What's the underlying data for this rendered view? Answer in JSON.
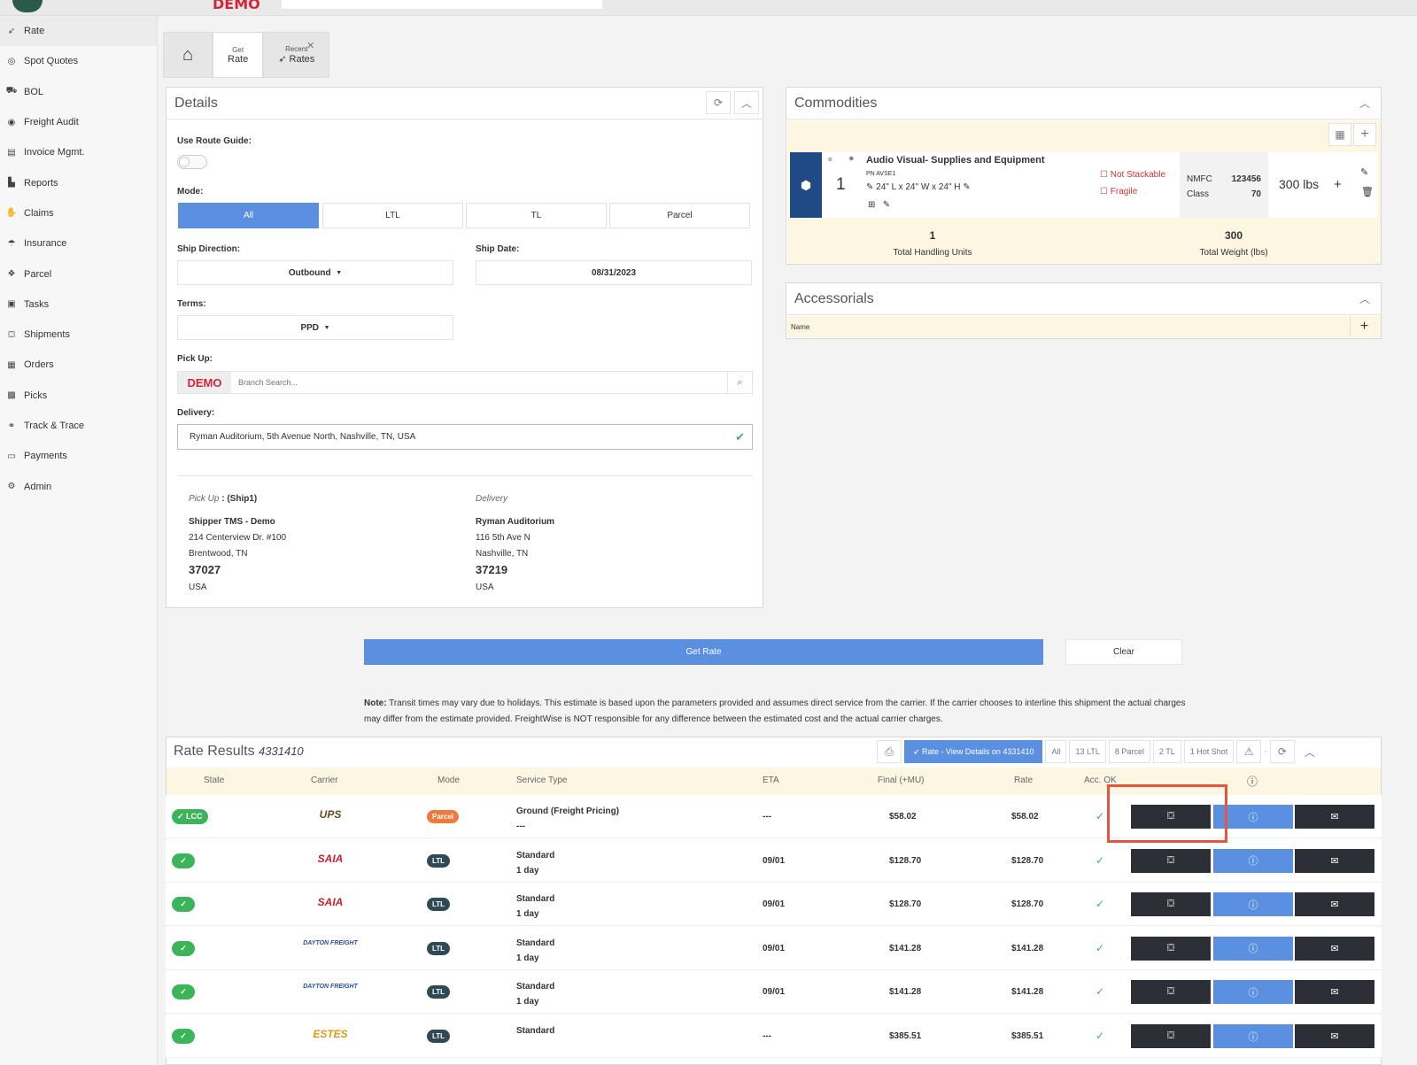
{
  "topbar": {
    "brand": "DEMO"
  },
  "sidebar": {
    "items": [
      {
        "label": "Rate",
        "icon": "paper-plane-icon"
      },
      {
        "label": "Spot Quotes",
        "icon": "target-icon"
      },
      {
        "label": "BOL",
        "icon": "truck-icon"
      },
      {
        "label": "Freight Audit",
        "icon": "eye-icon"
      },
      {
        "label": "Invoice Mgmt.",
        "icon": "file-icon"
      },
      {
        "label": "Reports",
        "icon": "chart-icon"
      },
      {
        "label": "Claims",
        "icon": "claim-icon"
      },
      {
        "label": "Insurance",
        "icon": "umbrella-icon"
      },
      {
        "label": "Parcel",
        "icon": "parcel-icon"
      },
      {
        "label": "Tasks",
        "icon": "clipboard-icon"
      },
      {
        "label": "Shipments",
        "icon": "dolly-icon"
      },
      {
        "label": "Orders",
        "icon": "box-icon"
      },
      {
        "label": "Picks",
        "icon": "boxes-icon"
      },
      {
        "label": "Track & Trace",
        "icon": "binoculars-icon"
      },
      {
        "label": "Payments",
        "icon": "money-icon"
      },
      {
        "label": "Admin",
        "icon": "cogs-icon"
      }
    ]
  },
  "tabs": [
    {
      "small": "Get",
      "label": "Rate"
    },
    {
      "small": "Recent",
      "label": "Rates"
    }
  ],
  "details": {
    "title": "Details",
    "route_guide_label": "Use Route Guide:",
    "mode_label": "Mode:",
    "modes": [
      "All",
      "LTL",
      "TL",
      "Parcel"
    ],
    "ship_direction_label": "Ship Direction:",
    "ship_direction": "Outbound",
    "ship_date_label": "Ship Date:",
    "ship_date": "08/31/2023",
    "terms_label": "Terms:",
    "terms": "PPD",
    "pickup_label": "Pick Up:",
    "pickup_brand": "DEMO",
    "pickup_placeholder": "Branch Search...",
    "delivery_label": "Delivery:",
    "delivery_value": "Ryman Auditorium, 5th Avenue North, Nashville, TN, USA",
    "pickup_addr": {
      "heading": "Pick Up",
      "sub": ": (Ship1)",
      "name": "Shipper TMS - Demo",
      "line1": "214 Centerview Dr. #100",
      "line2": "Brentwood, TN",
      "zip": "37027",
      "country": "USA"
    },
    "delivery_addr": {
      "heading": "Delivery",
      "name": "Ryman Auditorium",
      "line1": "116 5th Ave N",
      "line2": "Nashville, TN",
      "zip": "37219",
      "country": "USA"
    }
  },
  "commodities": {
    "title": "Commodities",
    "item": {
      "qty": "1",
      "name": "Audio Visual- Supplies and Equipment",
      "pn": "PN AVSE1",
      "dims": "24\" L x 24\" W x 24\" H",
      "not_stackable": "Not Stackable",
      "fragile": "Fragile",
      "nmfc_label": "NMFC",
      "nmfc": "123456",
      "class_label": "Class",
      "class": "70",
      "weight": "300 lbs"
    },
    "total_units": "1",
    "total_units_label": "Total Handling Units",
    "total_weight": "300",
    "total_weight_label": "Total Weight (lbs)"
  },
  "accessorials": {
    "title": "Accessorials",
    "col_name": "Name"
  },
  "actions": {
    "get_rate": "Get Rate",
    "clear": "Clear"
  },
  "note": {
    "label": "Note:",
    "text": "Transit times may vary due to holidays. This estimate is based upon the parameters provided and assumes direct service from the carrier. If the carrier chooses to interline this shipment the actual charges may differ from the estimate provided. FreightWise is NOT responsible for any difference between the estimated cost and the actual carrier charges."
  },
  "results": {
    "title": "Rate Results",
    "id": "4331410",
    "view_details": "Rate - View Details on 4331410",
    "filters": [
      "All",
      "13 LTL",
      "8 Parcel",
      "2 TL",
      "1 Hot Shot"
    ],
    "columns": [
      "State",
      "Carrier",
      "Mode",
      "Service Type",
      "ETA",
      "Final (+MU)",
      "Rate",
      "Acc. OK"
    ],
    "rows": [
      {
        "state": "✓ LCC",
        "carrier": "UPS",
        "mode": "Parcel",
        "service": "Ground (Freight Pricing)",
        "service2": "---",
        "eta": "---",
        "final": "$58.02",
        "rate": "$58.02"
      },
      {
        "state": "✓",
        "carrier": "SAIA",
        "mode": "LTL",
        "service": "Standard",
        "service2": "1 day",
        "eta": "09/01",
        "final": "$128.70",
        "rate": "$128.70"
      },
      {
        "state": "✓",
        "carrier": "SAIA",
        "mode": "LTL",
        "service": "Standard",
        "service2": "1 day",
        "eta": "09/01",
        "final": "$128.70",
        "rate": "$128.70"
      },
      {
        "state": "✓",
        "carrier": "DAYTON FREIGHT",
        "mode": "LTL",
        "service": "Standard",
        "service2": "1 day",
        "eta": "09/01",
        "final": "$141.28",
        "rate": "$141.28"
      },
      {
        "state": "✓",
        "carrier": "DAYTON FREIGHT",
        "mode": "LTL",
        "service": "Standard",
        "service2": "1 day",
        "eta": "09/01",
        "final": "$141.28",
        "rate": "$141.28"
      },
      {
        "state": "✓",
        "carrier": "ESTES",
        "mode": "LTL",
        "service": "Standard",
        "service2": "",
        "eta": "---",
        "final": "$385.51",
        "rate": "$385.51"
      }
    ]
  },
  "colors": {
    "accent": "#5b8fe0",
    "dark": "#2d2f36",
    "success": "#3cb45a",
    "parcel": "#ef7a3b",
    "ltl": "#2f4a55",
    "highlight": "#e8553f"
  }
}
